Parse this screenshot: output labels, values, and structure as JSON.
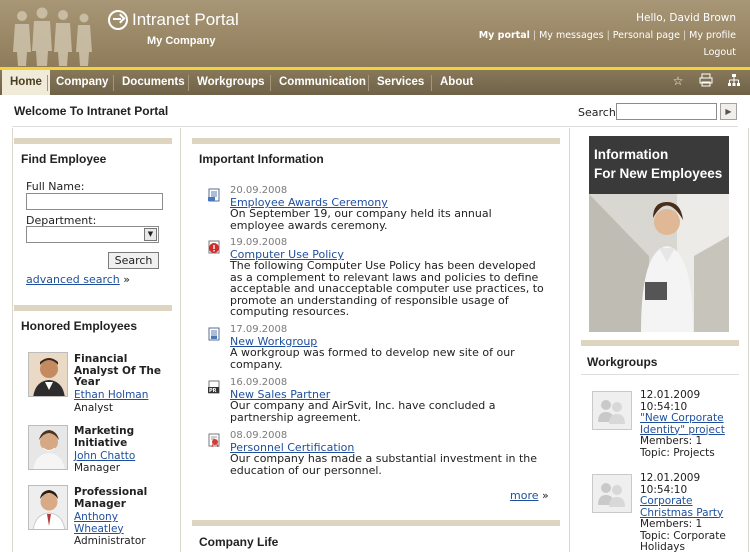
{
  "header": {
    "portal_title": "Intranet Portal",
    "company": "My Company",
    "greeting": "Hello, David Brown",
    "links": [
      "My portal",
      "My messages",
      "Personal page",
      "My profile"
    ],
    "logout": "Logout"
  },
  "nav": {
    "items": [
      "Home",
      "Company",
      "Documents",
      "Workgroups",
      "Communication",
      "Services",
      "About"
    ],
    "active": "Home",
    "icons": [
      "star-icon",
      "print-icon",
      "sitemap-icon"
    ]
  },
  "page": {
    "title": "Welcome To Intranet Portal",
    "search_label": "Search",
    "search_value": ""
  },
  "find_employee": {
    "title": "Find Employee",
    "full_name_label": "Full Name:",
    "full_name_value": "",
    "department_label": "Department:",
    "department_value": "",
    "search_button": "Search",
    "advanced_search": "advanced search",
    "advanced_arrow": "»"
  },
  "honored": {
    "title": "Honored Employees",
    "items": [
      {
        "award": "Financial Analyst Of The Year",
        "name": "Ethan Holman",
        "role": "Analyst"
      },
      {
        "award": "Marketing Initiative",
        "name": "John Chatto",
        "role": "Manager"
      },
      {
        "award": "Professional Manager",
        "name": "Anthony Wheatley",
        "role": "Administrator"
      }
    ]
  },
  "important": {
    "title": "Important Information",
    "items": [
      {
        "date": "20.09.2008",
        "title": "Employee Awards Ceremony",
        "text": "On September 19, our company held its annual employee awards ceremony.",
        "icon": "document-icon"
      },
      {
        "date": "19.09.2008",
        "title": "Computer Use Policy",
        "text": "The following Computer Use Policy has been developed as a complement to relevant laws and policies to define acceptable and unacceptable computer use practices, to promote an understanding of responsible usage of computing resources.",
        "icon": "alert-icon"
      },
      {
        "date": "17.09.2008",
        "title": "New Workgroup",
        "text": "A workgroup was formed to develop new site of our company.",
        "icon": "document-icon"
      },
      {
        "date": "16.09.2008",
        "title": "New Sales Partner",
        "text": "Our company and AirSvit, Inc. have concluded a partnership agreement.",
        "icon": "pr-icon"
      },
      {
        "date": "08.09.2008",
        "title": "Personnel Certification",
        "text": "Our company has made a substantial investment in the education of our personnel.",
        "icon": "certificate-icon"
      }
    ],
    "more": "more",
    "more_arrow": "»"
  },
  "company_life": {
    "title": "Company Life"
  },
  "banner": {
    "line1": "Information",
    "line2": "For New Employees"
  },
  "workgroups": {
    "title": "Workgroups",
    "items": [
      {
        "date": "12.01.2009",
        "time": "10:54:10",
        "name": "\"New Corporate Identity\" project",
        "members": "Members: 1",
        "topic": "Topic: Projects"
      },
      {
        "date": "12.01.2009",
        "time": "10:54:10",
        "name": "Corporate Christmas Party",
        "members": "Members: 1",
        "topic": "Topic: Corporate Holidays"
      }
    ]
  },
  "colors": {
    "header": "#9a8866",
    "nav": "#7a6c50",
    "accent": "#f2d33a",
    "band": "#ddd5bf",
    "link": "#1f4f9c"
  }
}
